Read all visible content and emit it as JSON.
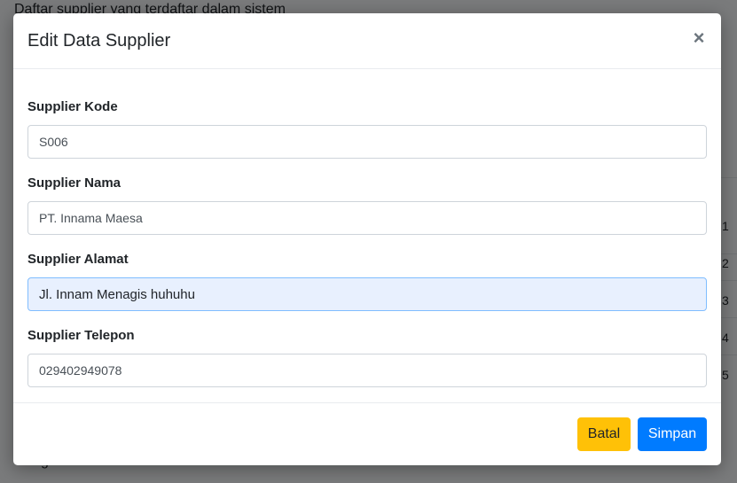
{
  "background": {
    "subtitle": "Daftar supplier yang terdaftar dalam sistem",
    "row_numbers": [
      "1",
      "2",
      "3",
      "4",
      "5"
    ],
    "footer_text": "g"
  },
  "modal": {
    "title": "Edit Data Supplier",
    "close_symbol": "×",
    "fields": [
      {
        "label": "Supplier Kode",
        "value": "S006"
      },
      {
        "label": "Supplier Nama",
        "value": "PT. Innama Maesa"
      },
      {
        "label": "Supplier Alamat",
        "value": "Jl. Innam Menagis huhuhu"
      },
      {
        "label": "Supplier Telepon",
        "value": "029402949078"
      }
    ],
    "buttons": {
      "cancel_label": "Batal",
      "save_label": "Simpan"
    }
  },
  "colors": {
    "primary": "#007bff",
    "warning": "#ffc107",
    "focused_input_bg": "#e8f0fe"
  }
}
